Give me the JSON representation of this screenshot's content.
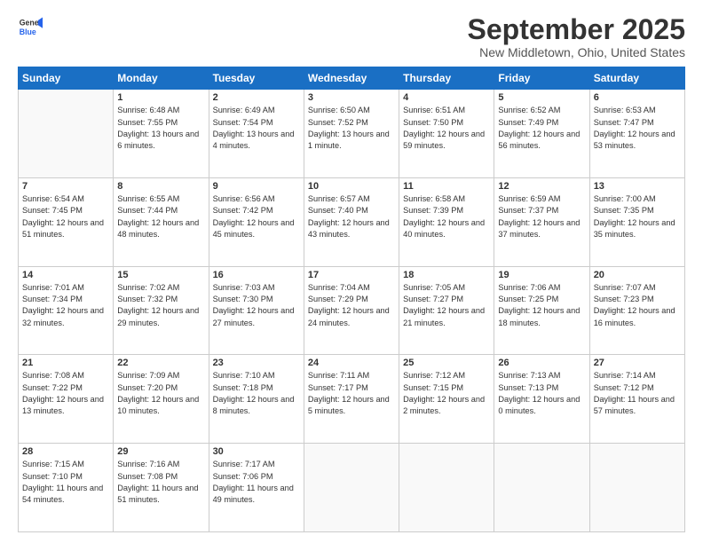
{
  "header": {
    "logo": {
      "general": "General",
      "blue": "Blue"
    },
    "title": "September 2025",
    "location": "New Middletown, Ohio, United States"
  },
  "calendar": {
    "days_of_week": [
      "Sunday",
      "Monday",
      "Tuesday",
      "Wednesday",
      "Thursday",
      "Friday",
      "Saturday"
    ],
    "weeks": [
      [
        {
          "day": "",
          "sunrise": "",
          "sunset": "",
          "daylight": ""
        },
        {
          "day": "1",
          "sunrise": "Sunrise: 6:48 AM",
          "sunset": "Sunset: 7:55 PM",
          "daylight": "Daylight: 13 hours and 6 minutes."
        },
        {
          "day": "2",
          "sunrise": "Sunrise: 6:49 AM",
          "sunset": "Sunset: 7:54 PM",
          "daylight": "Daylight: 13 hours and 4 minutes."
        },
        {
          "day": "3",
          "sunrise": "Sunrise: 6:50 AM",
          "sunset": "Sunset: 7:52 PM",
          "daylight": "Daylight: 13 hours and 1 minute."
        },
        {
          "day": "4",
          "sunrise": "Sunrise: 6:51 AM",
          "sunset": "Sunset: 7:50 PM",
          "daylight": "Daylight: 12 hours and 59 minutes."
        },
        {
          "day": "5",
          "sunrise": "Sunrise: 6:52 AM",
          "sunset": "Sunset: 7:49 PM",
          "daylight": "Daylight: 12 hours and 56 minutes."
        },
        {
          "day": "6",
          "sunrise": "Sunrise: 6:53 AM",
          "sunset": "Sunset: 7:47 PM",
          "daylight": "Daylight: 12 hours and 53 minutes."
        }
      ],
      [
        {
          "day": "7",
          "sunrise": "Sunrise: 6:54 AM",
          "sunset": "Sunset: 7:45 PM",
          "daylight": "Daylight: 12 hours and 51 minutes."
        },
        {
          "day": "8",
          "sunrise": "Sunrise: 6:55 AM",
          "sunset": "Sunset: 7:44 PM",
          "daylight": "Daylight: 12 hours and 48 minutes."
        },
        {
          "day": "9",
          "sunrise": "Sunrise: 6:56 AM",
          "sunset": "Sunset: 7:42 PM",
          "daylight": "Daylight: 12 hours and 45 minutes."
        },
        {
          "day": "10",
          "sunrise": "Sunrise: 6:57 AM",
          "sunset": "Sunset: 7:40 PM",
          "daylight": "Daylight: 12 hours and 43 minutes."
        },
        {
          "day": "11",
          "sunrise": "Sunrise: 6:58 AM",
          "sunset": "Sunset: 7:39 PM",
          "daylight": "Daylight: 12 hours and 40 minutes."
        },
        {
          "day": "12",
          "sunrise": "Sunrise: 6:59 AM",
          "sunset": "Sunset: 7:37 PM",
          "daylight": "Daylight: 12 hours and 37 minutes."
        },
        {
          "day": "13",
          "sunrise": "Sunrise: 7:00 AM",
          "sunset": "Sunset: 7:35 PM",
          "daylight": "Daylight: 12 hours and 35 minutes."
        }
      ],
      [
        {
          "day": "14",
          "sunrise": "Sunrise: 7:01 AM",
          "sunset": "Sunset: 7:34 PM",
          "daylight": "Daylight: 12 hours and 32 minutes."
        },
        {
          "day": "15",
          "sunrise": "Sunrise: 7:02 AM",
          "sunset": "Sunset: 7:32 PM",
          "daylight": "Daylight: 12 hours and 29 minutes."
        },
        {
          "day": "16",
          "sunrise": "Sunrise: 7:03 AM",
          "sunset": "Sunset: 7:30 PM",
          "daylight": "Daylight: 12 hours and 27 minutes."
        },
        {
          "day": "17",
          "sunrise": "Sunrise: 7:04 AM",
          "sunset": "Sunset: 7:29 PM",
          "daylight": "Daylight: 12 hours and 24 minutes."
        },
        {
          "day": "18",
          "sunrise": "Sunrise: 7:05 AM",
          "sunset": "Sunset: 7:27 PM",
          "daylight": "Daylight: 12 hours and 21 minutes."
        },
        {
          "day": "19",
          "sunrise": "Sunrise: 7:06 AM",
          "sunset": "Sunset: 7:25 PM",
          "daylight": "Daylight: 12 hours and 18 minutes."
        },
        {
          "day": "20",
          "sunrise": "Sunrise: 7:07 AM",
          "sunset": "Sunset: 7:23 PM",
          "daylight": "Daylight: 12 hours and 16 minutes."
        }
      ],
      [
        {
          "day": "21",
          "sunrise": "Sunrise: 7:08 AM",
          "sunset": "Sunset: 7:22 PM",
          "daylight": "Daylight: 12 hours and 13 minutes."
        },
        {
          "day": "22",
          "sunrise": "Sunrise: 7:09 AM",
          "sunset": "Sunset: 7:20 PM",
          "daylight": "Daylight: 12 hours and 10 minutes."
        },
        {
          "day": "23",
          "sunrise": "Sunrise: 7:10 AM",
          "sunset": "Sunset: 7:18 PM",
          "daylight": "Daylight: 12 hours and 8 minutes."
        },
        {
          "day": "24",
          "sunrise": "Sunrise: 7:11 AM",
          "sunset": "Sunset: 7:17 PM",
          "daylight": "Daylight: 12 hours and 5 minutes."
        },
        {
          "day": "25",
          "sunrise": "Sunrise: 7:12 AM",
          "sunset": "Sunset: 7:15 PM",
          "daylight": "Daylight: 12 hours and 2 minutes."
        },
        {
          "day": "26",
          "sunrise": "Sunrise: 7:13 AM",
          "sunset": "Sunset: 7:13 PM",
          "daylight": "Daylight: 12 hours and 0 minutes."
        },
        {
          "day": "27",
          "sunrise": "Sunrise: 7:14 AM",
          "sunset": "Sunset: 7:12 PM",
          "daylight": "Daylight: 11 hours and 57 minutes."
        }
      ],
      [
        {
          "day": "28",
          "sunrise": "Sunrise: 7:15 AM",
          "sunset": "Sunset: 7:10 PM",
          "daylight": "Daylight: 11 hours and 54 minutes."
        },
        {
          "day": "29",
          "sunrise": "Sunrise: 7:16 AM",
          "sunset": "Sunset: 7:08 PM",
          "daylight": "Daylight: 11 hours and 51 minutes."
        },
        {
          "day": "30",
          "sunrise": "Sunrise: 7:17 AM",
          "sunset": "Sunset: 7:06 PM",
          "daylight": "Daylight: 11 hours and 49 minutes."
        },
        {
          "day": "",
          "sunrise": "",
          "sunset": "",
          "daylight": ""
        },
        {
          "day": "",
          "sunrise": "",
          "sunset": "",
          "daylight": ""
        },
        {
          "day": "",
          "sunrise": "",
          "sunset": "",
          "daylight": ""
        },
        {
          "day": "",
          "sunrise": "",
          "sunset": "",
          "daylight": ""
        }
      ]
    ]
  }
}
